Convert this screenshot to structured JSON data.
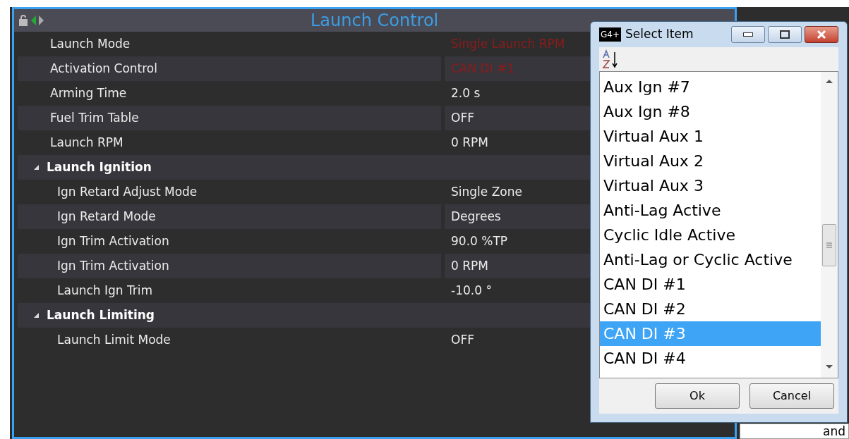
{
  "panel": {
    "title": "Launch Control"
  },
  "rows": [
    {
      "kind": "setting",
      "label": "Launch Mode",
      "value": "Single Launch RPM",
      "changed": true
    },
    {
      "kind": "setting",
      "label": "Activation Control",
      "value": "CAN DI #1",
      "changed": true
    },
    {
      "kind": "setting",
      "label": "Arming Time",
      "value": "2.0 s",
      "changed": false
    },
    {
      "kind": "setting",
      "label": "Fuel Trim Table",
      "value": "OFF",
      "changed": false
    },
    {
      "kind": "setting",
      "label": "Launch RPM",
      "value": "0 RPM",
      "changed": false
    },
    {
      "kind": "group",
      "label": "Launch Ignition",
      "expanded": true,
      "children": [
        {
          "label": "Ign Retard Adjust Mode",
          "value": "Single Zone",
          "changed": false
        },
        {
          "label": "Ign Retard Mode",
          "value": "Degrees",
          "changed": false
        },
        {
          "label": "Ign Trim Activation",
          "value": "90.0 %TP",
          "changed": false
        },
        {
          "label": "Ign Trim Activation",
          "value": "0 RPM",
          "changed": false
        },
        {
          "label": "Launch Ign Trim",
          "value": "-10.0 °",
          "changed": false
        }
      ]
    },
    {
      "kind": "group",
      "label": "Launch Limiting",
      "expanded": true,
      "children": [
        {
          "label": "Launch Limit Mode",
          "value": "OFF",
          "changed": false
        }
      ]
    }
  ],
  "dialog": {
    "app_icon": "G4+",
    "title": "Select Item",
    "items": [
      {
        "label": "Aux Ign #7",
        "selected": false
      },
      {
        "label": "Aux Ign #8",
        "selected": false
      },
      {
        "label": "Virtual Aux 1",
        "selected": false
      },
      {
        "label": "Virtual Aux 2",
        "selected": false
      },
      {
        "label": "Virtual Aux 3",
        "selected": false
      },
      {
        "label": "Anti-Lag Active",
        "selected": false
      },
      {
        "label": "Cyclic Idle  Active",
        "selected": false
      },
      {
        "label": "Anti-Lag or Cyclic Active",
        "selected": false
      },
      {
        "label": "CAN DI #1",
        "selected": false
      },
      {
        "label": "CAN DI #2",
        "selected": false
      },
      {
        "label": "CAN DI #3",
        "selected": true
      },
      {
        "label": "CAN DI #4",
        "selected": false
      }
    ],
    "buttons": [
      "Ok",
      "Cancel"
    ]
  },
  "background_field": {
    "value": "and"
  }
}
